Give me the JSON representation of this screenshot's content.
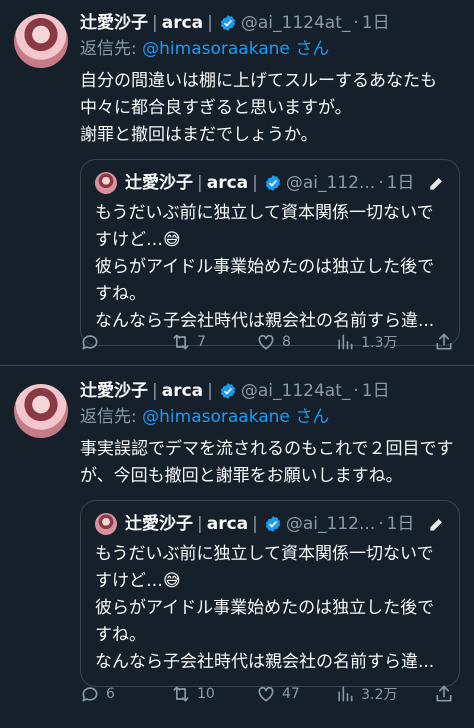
{
  "tweets": [
    {
      "name": "辻愛沙子",
      "sep1": "|",
      "brand": "arca",
      "sep2": "|",
      "handle": "@ai_1124at_",
      "dot": "·",
      "time": "1日",
      "reply_prefix": "返信先:",
      "reply_handle": "@himasoraakane",
      "reply_suffix": "さん",
      "text": "自分の間違いは棚に上げてスルーするあなたも\n中々に都合良すぎると思いますが。\n謝罪と撤回はまだでしょうか。",
      "quote": {
        "name": "辻愛沙子",
        "sep1": "|",
        "brand": "arca",
        "sep2": "|",
        "handle": "@ai_112...",
        "dot": "·",
        "time": "1日",
        "text": "もうだいぶ前に独立して資本関係一切ないで\nすけど…😅\n彼らがアイドル事業始めたのは独立した後で\nすね。\nなんなら子会社時代は親会社の名前すら違..."
      },
      "replies": "",
      "retweets": "7",
      "likes": "8",
      "views": "1.3万"
    },
    {
      "name": "辻愛沙子",
      "sep1": "|",
      "brand": "arca",
      "sep2": "|",
      "handle": "@ai_1124at_",
      "dot": "·",
      "time": "1日",
      "reply_prefix": "返信先:",
      "reply_handle": "@himasoraakane",
      "reply_suffix": "さん",
      "text": "事実誤認でデマを流されるのもこれで２回目です\nが、今回も撤回と謝罪をお願いしますね。",
      "quote": {
        "name": "辻愛沙子",
        "sep1": "|",
        "brand": "arca",
        "sep2": "|",
        "handle": "@ai_112...",
        "dot": "·",
        "time": "1日",
        "text": "もうだいぶ前に独立して資本関係一切ないで\nすけど…😅\n彼らがアイドル事業始めたのは独立した後で\nすね。\nなんなら子会社時代は親会社の名前すら違..."
      },
      "replies": "6",
      "retweets": "10",
      "likes": "47",
      "views": "3.2万"
    }
  ],
  "colors": {
    "background": "#15202b",
    "link": "#1d9bf0",
    "muted": "#8b98a5",
    "verified": "#1d9bf0"
  },
  "icons": [
    "verified-badge-icon",
    "grok-edit-icon",
    "reply-icon",
    "retweet-icon",
    "like-icon",
    "views-icon",
    "share-icon"
  ]
}
